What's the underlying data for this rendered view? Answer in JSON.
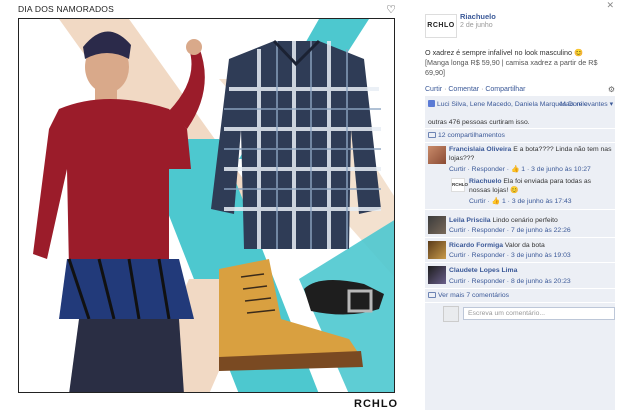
{
  "campaign": {
    "title": "DIA DOS NAMORADOS",
    "brand": "RCHLO"
  },
  "page": {
    "avatar_text": "RCHLO",
    "name": "Riachuelo",
    "date": "2 de junho"
  },
  "post": {
    "line1": "O xadrez é sempre infalível no look masculino 😊",
    "line2": "[Manga longa R$ 59,90 | camisa xadrez a partir de R$ 69,90]"
  },
  "actions": {
    "like": "Curtir",
    "comment": "Comentar",
    "share": "Compartilhar",
    "dot": "·"
  },
  "likes": {
    "names": "Luci Silva, Lene Macedo, Daniela Marques Doni e",
    "others": "outras 476 pessoas curtiram isso.",
    "most_relevant": "Mais relevantes ▾",
    "shares": "12 compartilhamentos"
  },
  "comments": [
    {
      "author": "Francislaia Oliveira",
      "text": "E a bota???? Linda não tem nas lojas???",
      "meta": "Curtir · Responder · 👍 1 · 3 de junho às 10:27"
    },
    {
      "author": "Riachuelo",
      "text": "Ela foi enviada para todas as nossas lojas! 😊",
      "meta": "Curtir · 👍 1 · 3 de junho às 17:43",
      "avatar_text": "RCHLO"
    },
    {
      "author": "Leila Priscila",
      "text": "Lindo cenário perfeito",
      "meta": "Curtir · Responder · 7 de junho às 22:26"
    },
    {
      "author": "Ricardo Formiga",
      "text": "Valor da bota",
      "meta": "Curtir · Responder · 3 de junho às 19:03"
    },
    {
      "author": "Claudete Lopes Lima",
      "text": "",
      "meta": "Curtir · Responder · 8 de junho às 20:23"
    }
  ],
  "more_comments": "Ver mais 7 comentários",
  "comment_placeholder": "Escreva um comentário...",
  "colors": {
    "link": "#3b5998",
    "feedback_bg": "#eceff5",
    "accent_teal": "#4dc8cf",
    "shirt_red": "#9b1c2a"
  }
}
